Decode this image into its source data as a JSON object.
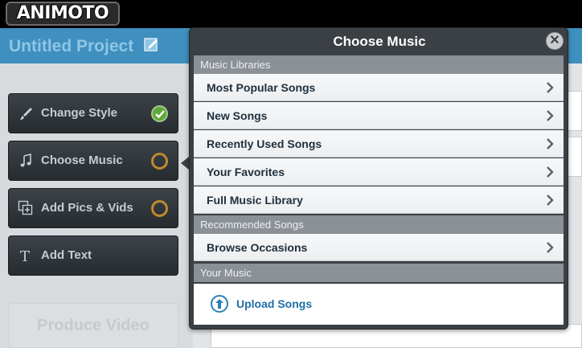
{
  "brand": {
    "logo_text": "ANIMOTO"
  },
  "project": {
    "title": "Untitled Project"
  },
  "steps": [
    {
      "label": "Change Style",
      "status": "complete",
      "icon": "brush-icon"
    },
    {
      "label": "Choose Music",
      "status": "incomplete",
      "icon": "music-note-icon"
    },
    {
      "label": "Add Pics & Vids",
      "status": "incomplete",
      "icon": "add-media-icon"
    },
    {
      "label": "Add Text",
      "status": "none",
      "icon": "text-icon"
    }
  ],
  "produce_button": {
    "label": "Produce Video"
  },
  "modal": {
    "title": "Choose Music",
    "close_icon": "close-icon",
    "sections": [
      {
        "heading": "Music Libraries",
        "items": [
          "Most Popular Songs",
          "New Songs",
          "Recently Used Songs",
          "Your Favorites",
          "Full Music Library"
        ]
      },
      {
        "heading": "Recommended Songs",
        "items": [
          "Browse Occasions"
        ]
      },
      {
        "heading": "Your Music",
        "upload_label": "Upload Songs"
      }
    ]
  },
  "colors": {
    "top_bar": "#000000",
    "project_bar": "#3f8fbf",
    "complete_green": "#5fa93a",
    "incomplete_orange": "#c08a2c",
    "link_blue": "#1f6fa6"
  }
}
